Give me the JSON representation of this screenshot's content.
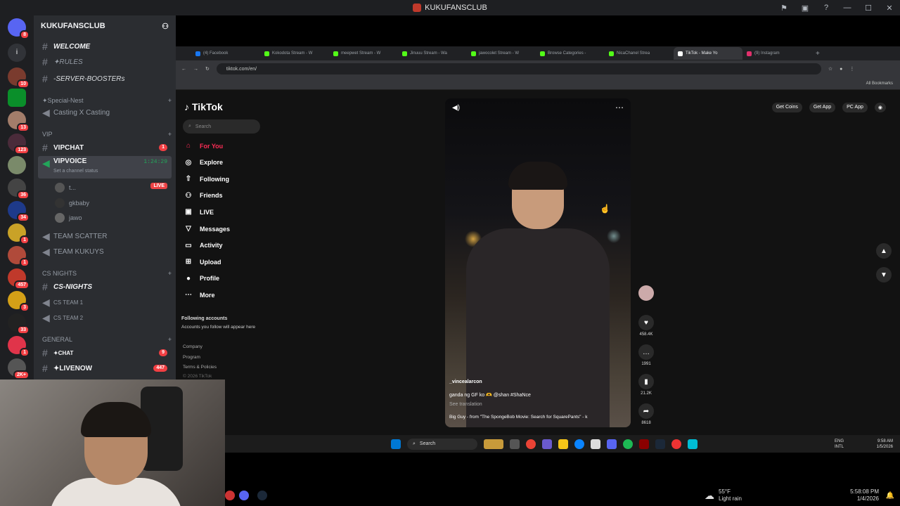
{
  "window": {
    "title": "KUKUFANSCLUB"
  },
  "server_rail": {
    "badges": [
      "8",
      "10",
      "13",
      "123",
      "36",
      "34",
      "1",
      "1",
      "1",
      "457",
      "3",
      "33",
      "1",
      "2K+"
    ]
  },
  "channels": {
    "server_name": "KUKUFANSCLUB",
    "welcome": "WELCOME",
    "rules": "✦RULES",
    "boosters": "-SERVER-BOOSTERs",
    "cat_special": "✦Special-Nest",
    "casting": "Casting X Casting",
    "cat_vip": "VIP",
    "vipchat": "VIPCHAT",
    "vipchat_badge": "1",
    "vipvoice": "VIPVOICE",
    "vipvoice_time": "1:24:29",
    "channel_status": "Set a channel status",
    "voice_users": [
      "t...",
      "gkbaby",
      "jawo"
    ],
    "live_label": "LIVE",
    "team_scatter": "TEAM SCATTER",
    "team_kukuys": "TEAM KUKUYS",
    "cat_cs": "CS NIGHTS",
    "cs_nights": "CS-NIGHTS",
    "cs_team1": "CS TEAM 1",
    "cs_team2": "CS TEAM 2",
    "cat_general": "GENERAL",
    "chat": "✦CHAT",
    "chat_badge": "9",
    "livenow": "✦LIVENOW",
    "livenow_badge": "447"
  },
  "browser": {
    "tabs": [
      {
        "label": "(4) Facebook",
        "color": "#1877f2",
        "active": false
      },
      {
        "label": "Kokodota Stream - W",
        "color": "#53fc18",
        "active": false
      },
      {
        "label": "meepwet Stream - W",
        "color": "#53fc18",
        "active": false
      },
      {
        "label": "Jinuuu Stream - Wa",
        "color": "#53fc18",
        "active": false
      },
      {
        "label": "jawocolet Stream - W",
        "color": "#53fc18",
        "active": false
      },
      {
        "label": "Browse Categories -",
        "color": "#53fc18",
        "active": false
      },
      {
        "label": "NicaChanel Strea",
        "color": "#53fc18",
        "active": false
      },
      {
        "label": "TikTok - Make Yo",
        "color": "#ffffff",
        "active": true
      },
      {
        "label": "(9) Instagram",
        "color": "#e1306c",
        "active": false
      }
    ],
    "url": "tiktok.com/en/",
    "all_bookmarks": "All Bookmarks"
  },
  "tiktok": {
    "logo": "TikTok",
    "search_placeholder": "Search",
    "nav": [
      {
        "label": "For You",
        "icon": "home-icon",
        "glyph": "⌂"
      },
      {
        "label": "Explore",
        "icon": "compass-icon",
        "glyph": "◎"
      },
      {
        "label": "Following",
        "icon": "following-icon",
        "glyph": "⇧"
      },
      {
        "label": "Friends",
        "icon": "friends-icon",
        "glyph": "⚇"
      },
      {
        "label": "LIVE",
        "icon": "live-icon",
        "glyph": "▣"
      },
      {
        "label": "Messages",
        "icon": "messages-icon",
        "glyph": "▽"
      },
      {
        "label": "Activity",
        "icon": "activity-icon",
        "glyph": "▭"
      },
      {
        "label": "Upload",
        "icon": "upload-icon",
        "glyph": "⊞"
      },
      {
        "label": "Profile",
        "icon": "profile-icon",
        "glyph": "●"
      },
      {
        "label": "More",
        "icon": "more-icon",
        "glyph": "⋯"
      }
    ],
    "following_title": "Following accounts",
    "following_sub": "Accounts you follow will appear here",
    "footer": [
      "Company",
      "Program",
      "Terms & Policies",
      "© 2026 TikTok"
    ],
    "top_right": [
      "Get Coins",
      "Get App",
      "PC App"
    ],
    "video": {
      "username": "_vincealarcon",
      "caption": "ganda ng GF ko 🫶 @shan #ShaNce",
      "see_translation": "See translation",
      "music": "Big Guy - from \"The SpongeBob Movie: Search for SquarePants\" - k"
    },
    "actions": {
      "likes": "458.4K",
      "comments": "1991",
      "saves": "21.2K",
      "shares": "8618"
    }
  },
  "inner_taskbar": {
    "search": "Search",
    "lang1": "ENG",
    "lang2": "INTL",
    "time": "9:58 AM",
    "date": "1/5/2026"
  },
  "outer_taskbar": {
    "temp": "55°F",
    "weather": "Light rain",
    "time": "5:58:08 PM",
    "date": "1/4/2026"
  },
  "colors": {
    "discord_bg": "#2b2d31",
    "rail_bg": "#1e1f22",
    "tiktok_red": "#fe2c55",
    "badge_red": "#f23f43"
  }
}
